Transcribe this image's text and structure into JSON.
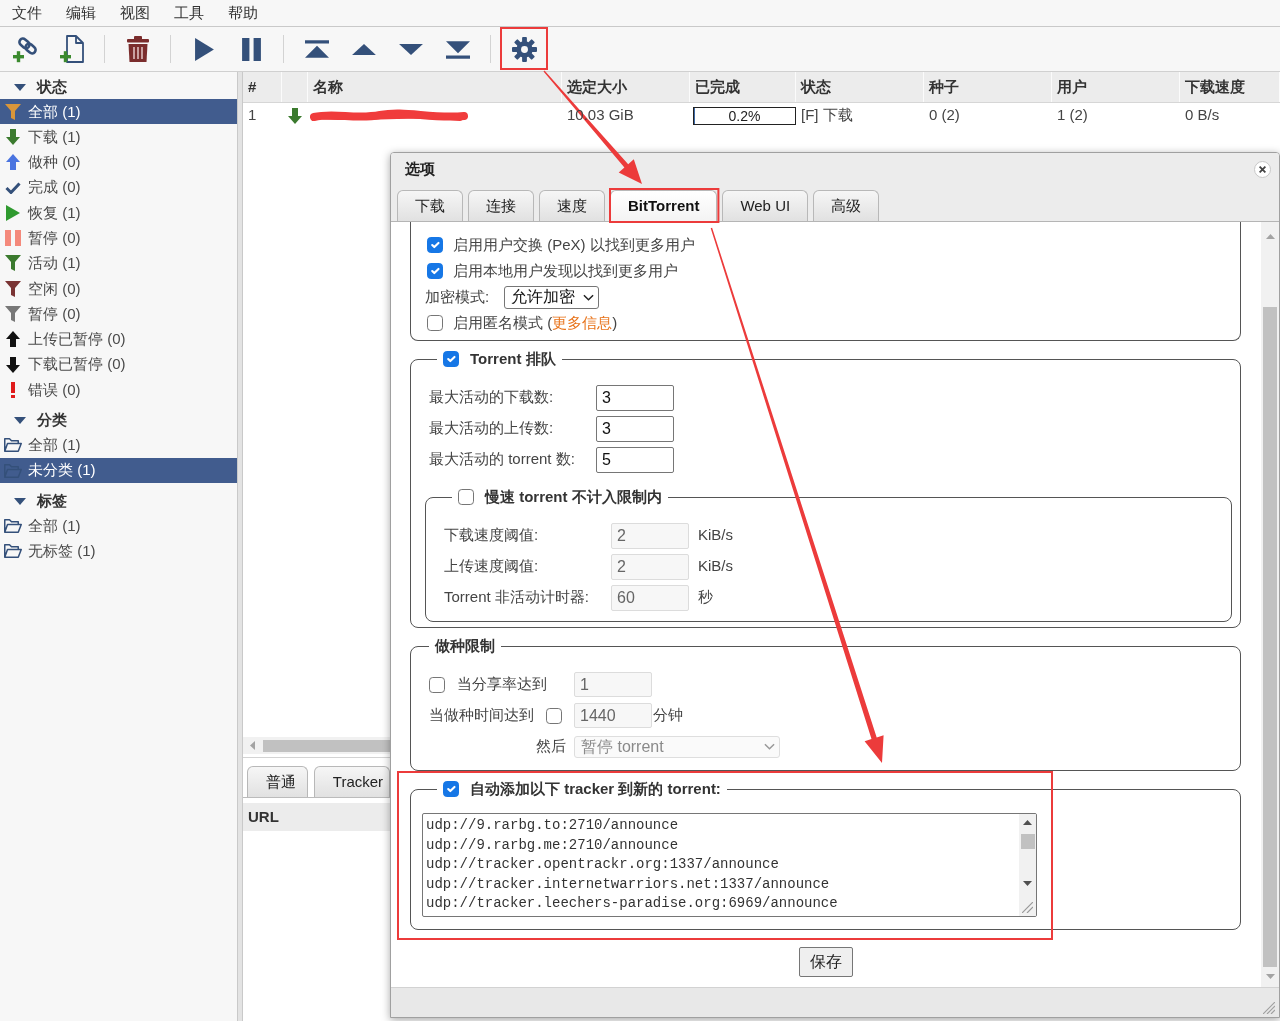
{
  "menu": [
    "文件",
    "编辑",
    "视图",
    "工具",
    "帮助"
  ],
  "sidebar": [
    {
      "title": "状态",
      "expanded": true,
      "items": [
        {
          "label": "全部 (1)",
          "kind": "all",
          "selected": true
        },
        {
          "label": "下载 (1)",
          "kind": "downloading",
          "selected": false
        },
        {
          "label": "做种 (0)",
          "kind": "seeding",
          "selected": false
        },
        {
          "label": "完成 (0)",
          "kind": "completed",
          "selected": false
        },
        {
          "label": "恢复 (1)",
          "kind": "resumed",
          "selected": false
        },
        {
          "label": "暂停 (0)",
          "kind": "paused",
          "selected": false
        },
        {
          "label": "活动 (1)",
          "kind": "active",
          "selected": false
        },
        {
          "label": "空闲 (0)",
          "kind": "inactive",
          "selected": false
        },
        {
          "label": "暂停 (0)",
          "kind": "stalled",
          "selected": false
        },
        {
          "label": "上传已暂停 (0)",
          "kind": "uploadpaused",
          "selected": false
        },
        {
          "label": "下载已暂停 (0)",
          "kind": "downloadpaused",
          "selected": false
        },
        {
          "label": "错误 (0)",
          "kind": "errored",
          "selected": false
        }
      ]
    },
    {
      "title": "分类",
      "expanded": true,
      "items": [
        {
          "label": "全部 (1)",
          "kind": "folder",
          "selected": false
        },
        {
          "label": "未分类 (1)",
          "kind": "folder",
          "selected": true
        }
      ]
    },
    {
      "title": "标签",
      "expanded": true,
      "items": [
        {
          "label": "全部 (1)",
          "kind": "folder",
          "selected": false
        },
        {
          "label": "无标签 (1)",
          "kind": "folder",
          "selected": false
        }
      ]
    }
  ],
  "table": {
    "columns": [
      {
        "kind": "text",
        "label": "#"
      },
      {
        "kind": "icon"
      },
      {
        "kind": "text",
        "label": "名称"
      },
      {
        "kind": "text",
        "label": "选定大小"
      },
      {
        "kind": "text",
        "label": "已完成"
      },
      {
        "kind": "text",
        "label": "状态"
      },
      {
        "kind": "text",
        "label": "种子"
      },
      {
        "kind": "text",
        "label": "用户"
      },
      {
        "kind": "text",
        "label": "下载速度"
      }
    ],
    "rows": [
      {
        "kind": "downloading",
        "number": "1",
        "name_redacted": true,
        "size": "10.03 GiB",
        "progress": {
          "text": "0.2%",
          "level": 0.002
        },
        "status": "[F] 下载",
        "seeds": "0 (2)",
        "peers": "1 (2)",
        "speed": "0 B/s"
      }
    ]
  },
  "details": {
    "tabs": [
      "普通",
      "Tracker"
    ],
    "columns": [
      "URL"
    ]
  },
  "dialog": {
    "title": "选项",
    "tabs": [
      {
        "label": "下载",
        "selected": false
      },
      {
        "label": "连接",
        "selected": false
      },
      {
        "label": "速度",
        "selected": false
      },
      {
        "label": "BitTorrent",
        "selected": true
      },
      {
        "label": "Web UI",
        "selected": false
      },
      {
        "label": "高级",
        "selected": false
      }
    ],
    "groups": [
      {
        "rows": [
          {
            "kind": "checkbox",
            "checked": true,
            "label": "启用用户交换 (PeX) 以找到更多用户"
          },
          {
            "kind": "checkbox",
            "checked": true,
            "label": "启用本地用户发现以找到更多用户"
          },
          {
            "kind": "select",
            "label": "加密模式:",
            "value": "允许加密"
          },
          {
            "kind": "checkbox",
            "checked": false,
            "label": "启用匿名模式 (",
            "link": "更多信息",
            "label_end": ")"
          }
        ]
      },
      {
        "legend": {
          "label": "Torrent 排队",
          "checked": true
        },
        "rows": [
          {
            "kind": "number",
            "label": "最大活动的下载数:",
            "value": "3",
            "disabled": false
          },
          {
            "kind": "number",
            "label": "最大活动的上传数:",
            "value": "3",
            "disabled": false
          },
          {
            "kind": "number",
            "label": "最大活动的 torrent 数:",
            "value": "5",
            "disabled": false
          },
          {
            "kind": "group",
            "legend": {
              "label": "慢速 torrent 不计入限制内",
              "checked": false
            },
            "rows": [
              {
                "kind": "number",
                "label": "下载速度阈值:",
                "value": "2",
                "unit": "KiB/s",
                "disabled": true
              },
              {
                "kind": "number",
                "label": "上传速度阈值:",
                "value": "2",
                "unit": "KiB/s",
                "disabled": true
              },
              {
                "kind": "number",
                "label": "Torrent 非活动计时器:",
                "value": "60",
                "unit": "秒",
                "disabled": true
              }
            ]
          }
        ]
      },
      {
        "legend": {
          "label": "做种限制"
        },
        "rows": [
          {
            "kind": "limit",
            "parts": [
              {
                "kind": "checkbox",
                "checked": false
              },
              {
                "kind": "text",
                "text": "当分享率达到"
              },
              {
                "kind": "input",
                "value": "1",
                "disabled": true
              }
            ]
          },
          {
            "kind": "limit",
            "parts": [
              {
                "kind": "text",
                "text": "当做种时间达到"
              },
              {
                "kind": "checkbox",
                "checked": false
              },
              {
                "kind": "input",
                "value": "1440",
                "disabled": true
              },
              {
                "kind": "text",
                "text": "分钟"
              }
            ]
          },
          {
            "kind": "limit",
            "parts": [
              {
                "kind": "text",
                "text": "然后"
              },
              {
                "kind": "select",
                "value": "暂停 torrent",
                "disabled": true
              }
            ]
          }
        ]
      },
      {
        "legend": {
          "label": "自动添加以下 tracker 到新的 torrent:",
          "checked": true
        },
        "rows": [
          {
            "kind": "textarea",
            "lines": [
              "udp://9.rarbg.to:2710/announce",
              "udp://9.rarbg.me:2710/announce",
              "udp://tracker.opentrackr.org:1337/announce",
              "udp://tracker.internetwarriors.net:1337/announce",
              "udp://tracker.leechers-paradise.org:6969/announce"
            ]
          }
        ]
      }
    ],
    "save": "保存"
  }
}
